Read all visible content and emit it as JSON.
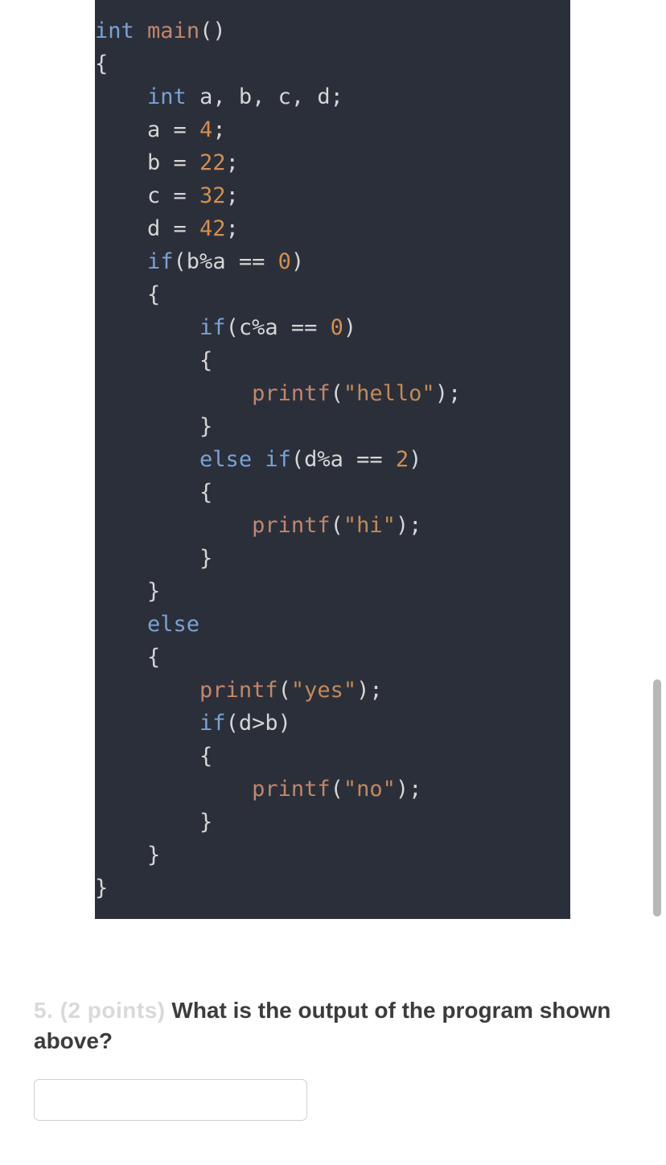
{
  "code": {
    "lines": [
      [
        {
          "cls": "kw",
          "t": "int"
        },
        {
          "cls": "op",
          "t": " "
        },
        {
          "cls": "fn",
          "t": "main"
        },
        {
          "cls": "op",
          "t": "()"
        }
      ],
      [
        {
          "cls": "op",
          "t": "{"
        }
      ],
      [
        {
          "cls": "op",
          "t": "    "
        },
        {
          "cls": "kw",
          "t": "int"
        },
        {
          "cls": "op",
          "t": " a, b, c, d;"
        }
      ],
      [
        {
          "cls": "op",
          "t": "    a = "
        },
        {
          "cls": "num",
          "t": "4"
        },
        {
          "cls": "op",
          "t": ";"
        }
      ],
      [
        {
          "cls": "op",
          "t": "    b = "
        },
        {
          "cls": "num",
          "t": "22"
        },
        {
          "cls": "op",
          "t": ";"
        }
      ],
      [
        {
          "cls": "op",
          "t": "    c = "
        },
        {
          "cls": "num",
          "t": "32"
        },
        {
          "cls": "op",
          "t": ";"
        }
      ],
      [
        {
          "cls": "op",
          "t": "    d = "
        },
        {
          "cls": "num",
          "t": "42"
        },
        {
          "cls": "op",
          "t": ";"
        }
      ],
      [
        {
          "cls": "op",
          "t": "    "
        },
        {
          "cls": "kw",
          "t": "if"
        },
        {
          "cls": "op",
          "t": "(b%a == "
        },
        {
          "cls": "num",
          "t": "0"
        },
        {
          "cls": "op",
          "t": ")"
        }
      ],
      [
        {
          "cls": "op",
          "t": "    {"
        }
      ],
      [
        {
          "cls": "op",
          "t": "        "
        },
        {
          "cls": "kw",
          "t": "if"
        },
        {
          "cls": "op",
          "t": "(c%a == "
        },
        {
          "cls": "num",
          "t": "0"
        },
        {
          "cls": "op",
          "t": ")"
        }
      ],
      [
        {
          "cls": "op",
          "t": "        {"
        }
      ],
      [
        {
          "cls": "op",
          "t": "            "
        },
        {
          "cls": "fn",
          "t": "printf"
        },
        {
          "cls": "op",
          "t": "("
        },
        {
          "cls": "str",
          "t": "\"hello\""
        },
        {
          "cls": "op",
          "t": ");"
        }
      ],
      [
        {
          "cls": "op",
          "t": "        }"
        }
      ],
      [
        {
          "cls": "op",
          "t": "        "
        },
        {
          "cls": "kw",
          "t": "else if"
        },
        {
          "cls": "op",
          "t": "(d%a == "
        },
        {
          "cls": "num",
          "t": "2"
        },
        {
          "cls": "op",
          "t": ")"
        }
      ],
      [
        {
          "cls": "op",
          "t": "        {"
        }
      ],
      [
        {
          "cls": "op",
          "t": "            "
        },
        {
          "cls": "fn",
          "t": "printf"
        },
        {
          "cls": "op",
          "t": "("
        },
        {
          "cls": "str",
          "t": "\"hi\""
        },
        {
          "cls": "op",
          "t": ");"
        }
      ],
      [
        {
          "cls": "op",
          "t": "        }"
        }
      ],
      [
        {
          "cls": "op",
          "t": "    }"
        }
      ],
      [
        {
          "cls": "op",
          "t": "    "
        },
        {
          "cls": "kw",
          "t": "else"
        }
      ],
      [
        {
          "cls": "op",
          "t": "    {"
        }
      ],
      [
        {
          "cls": "op",
          "t": "        "
        },
        {
          "cls": "fn",
          "t": "printf"
        },
        {
          "cls": "op",
          "t": "("
        },
        {
          "cls": "str",
          "t": "\"yes\""
        },
        {
          "cls": "op",
          "t": ");"
        }
      ],
      [
        {
          "cls": "op",
          "t": "        "
        },
        {
          "cls": "kw",
          "t": "if"
        },
        {
          "cls": "op",
          "t": "(d>b)"
        }
      ],
      [
        {
          "cls": "op",
          "t": "        {"
        }
      ],
      [
        {
          "cls": "op",
          "t": "            "
        },
        {
          "cls": "fn",
          "t": "printf"
        },
        {
          "cls": "op",
          "t": "("
        },
        {
          "cls": "str",
          "t": "\"no\""
        },
        {
          "cls": "op",
          "t": ");"
        }
      ],
      [
        {
          "cls": "op",
          "t": "        }"
        }
      ],
      [
        {
          "cls": "op",
          "t": "    }"
        }
      ],
      [
        {
          "cls": "op",
          "t": "}"
        }
      ]
    ]
  },
  "question": {
    "prefix": "5. (2 points)",
    "text": " What is the output of the program shown above?"
  },
  "answer": {
    "value": ""
  }
}
